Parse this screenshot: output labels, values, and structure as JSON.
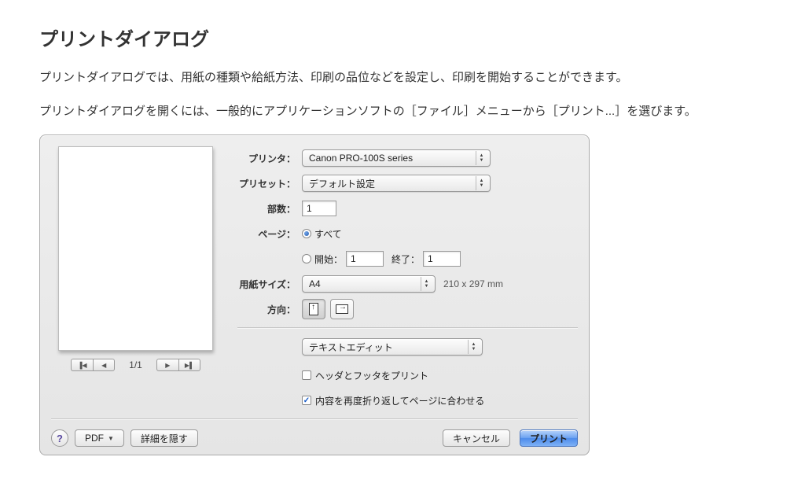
{
  "page": {
    "title": "プリントダイアログ",
    "p1": "プリントダイアログでは、用紙の種類や給紙方法、印刷の品位などを設定し、印刷を開始することができます。",
    "p2": "プリントダイアログを開くには、一般的にアプリケーションソフトの［ファイル］メニューから［プリント...］を選びます。"
  },
  "dialog": {
    "labels": {
      "printer": "プリンタ：",
      "preset": "プリセット：",
      "copies": "部数：",
      "pages": "ページ：",
      "from": "開始：",
      "to": "終了：",
      "paper_size": "用紙サイズ：",
      "orientation": "方向："
    },
    "values": {
      "printer": "Canon PRO-100S series",
      "preset": "デフォルト設定",
      "copies": "1",
      "pages_all": "すべて",
      "from_val": "1",
      "to_val": "1",
      "paper_size": "A4",
      "paper_dim": "210 x 297 mm",
      "section": "テキストエディット",
      "cb_headerfooter": "ヘッダとフッタをプリント",
      "cb_rewrap": "内容を再度折り返してページに合わせる"
    },
    "preview": {
      "indicator": "1/1"
    },
    "footer": {
      "help": "?",
      "pdf": "PDF",
      "hide_details": "詳細を隠す",
      "cancel": "キャンセル",
      "print": "プリント"
    }
  }
}
